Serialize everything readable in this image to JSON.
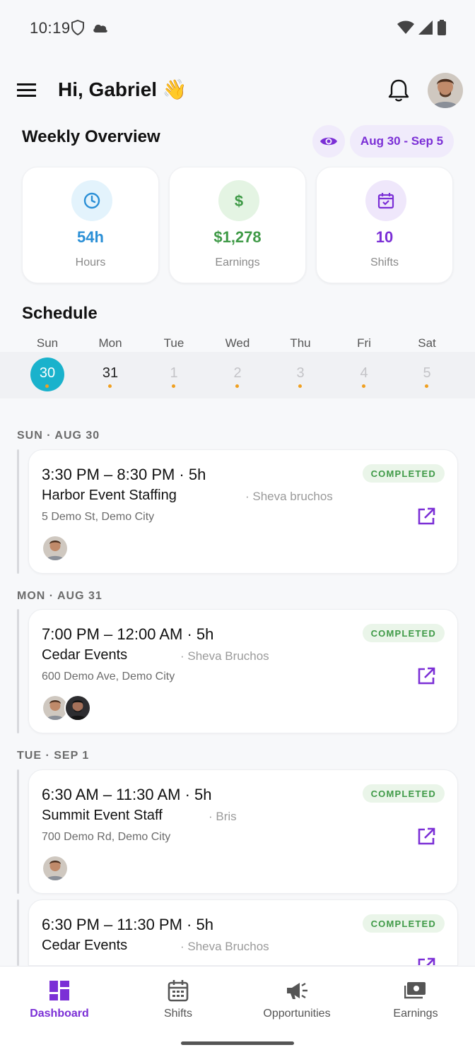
{
  "status_bar": {
    "time": "10:19"
  },
  "header": {
    "greeting": "Hi, Gabriel",
    "wave_emoji": "👋"
  },
  "overview": {
    "title": "Weekly Overview",
    "date_range": "Aug 30 - Sep 5",
    "stats": [
      {
        "value": "54h",
        "label": "Hours",
        "color": "#2a8fd6",
        "icon": "clock-icon"
      },
      {
        "value": "$1,278",
        "label": "Earnings",
        "color": "#3f9a47",
        "icon": "dollar-icon"
      },
      {
        "value": "10",
        "label": "Shifts",
        "color": "#7b2fd6",
        "icon": "calendar-check-icon"
      }
    ]
  },
  "schedule": {
    "title": "Schedule",
    "weekdays": [
      "Sun",
      "Mon",
      "Tue",
      "Wed",
      "Thu",
      "Fri",
      "Sat"
    ],
    "dates": [
      "30",
      "31",
      "1",
      "2",
      "3",
      "4",
      "5"
    ],
    "selected_index": 0
  },
  "shifts": [
    {
      "day_header": "SUN · AUG 30",
      "time": "3:30 PM – 8:30 PM  ·  5h",
      "name": "Harbor Event Staffing",
      "manager": "· Sheva bruchos",
      "address": "5 Demo St, Demo City",
      "status": "COMPLETED"
    },
    {
      "day_header": "MON · AUG 31",
      "time": "7:00 PM – 12:00 AM  ·  5h",
      "name": "Cedar Events",
      "manager": "· Sheva Bruchos",
      "address": "600 Demo Ave, Demo City",
      "status": "COMPLETED"
    },
    {
      "day_header": "TUE · SEP 1",
      "time": "6:30 AM – 11:30 AM  ·  5h",
      "name": "Summit Event Staff",
      "manager": "· Bris",
      "address": "700 Demo Rd, Demo City",
      "status": "COMPLETED"
    },
    {
      "time": "6:30 PM – 11:30 PM  ·  5h",
      "name": "Cedar Events",
      "manager": "· Sheva Bruchos",
      "status": "COMPLETED"
    }
  ],
  "nav": [
    {
      "label": "Dashboard",
      "icon": "dashboard-icon",
      "active": true
    },
    {
      "label": "Shifts",
      "icon": "calendar-icon",
      "active": false
    },
    {
      "label": "Opportunities",
      "icon": "megaphone-icon",
      "active": false
    },
    {
      "label": "Earnings",
      "icon": "wallet-icon",
      "active": false
    }
  ],
  "colors": {
    "accent": "#7b2fd6",
    "selected_date": "#1ab2cc",
    "dot": "#f0a020",
    "completed": "#3f9a47"
  }
}
